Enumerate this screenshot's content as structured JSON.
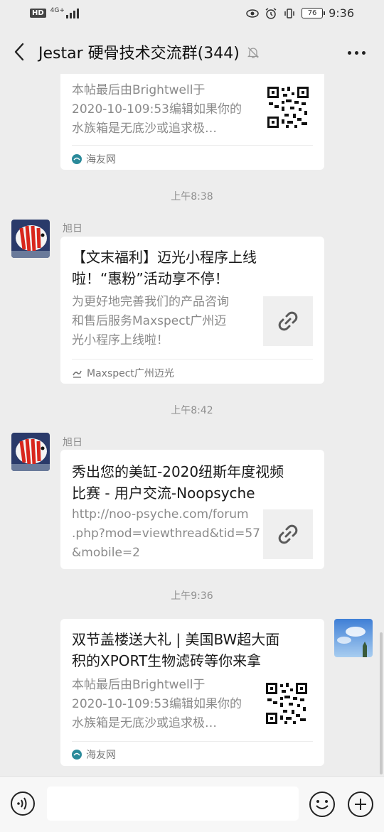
{
  "status": {
    "left_badge": "HD",
    "network": "4G+",
    "battery": "76",
    "time": "9:36"
  },
  "header": {
    "title": "Jestar 硬骨技术交流群(344)"
  },
  "messages": [
    {
      "desc": [
        "本帖最后由Brightwell于",
        "2020-10-109:53编辑如果你的",
        "水族箱是无底沙或追求极…"
      ],
      "source": "海友网"
    },
    {
      "time": "上午8:38",
      "sender": "旭日",
      "title": [
        "【文末福利】迈光小程序上线",
        "啦！“惠粉”活动享不停！"
      ],
      "desc": [
        "为更好地完善我们的产品咨询",
        "和售后服务Maxspect广州迈",
        "光小程序上线啦！"
      ],
      "source": "Maxspect广州迈光"
    },
    {
      "time": "上午8:42",
      "sender": "旭日",
      "title": [
        "秀出您的美缸-2020纽斯年度视频",
        "比赛 - 用户交流-Noopsyche"
      ],
      "desc": [
        "http://noo-psyche.com/forum",
        ".php?mod=viewthread&tid=57",
        "&mobile=2"
      ]
    },
    {
      "time": "上午9:36",
      "title": [
        "双节盖楼送大礼 | 美国BW超大面",
        "积的XPORT生物滤砖等你来拿"
      ],
      "desc": [
        "本帖最后由Brightwell于",
        "2020-10-109:53编辑如果你的",
        "水族箱是无底沙或追求极…"
      ],
      "source": "海友网"
    }
  ],
  "colors": {
    "background": "#ededed",
    "card": "#ffffff",
    "muted_text": "#8a8a8a"
  }
}
